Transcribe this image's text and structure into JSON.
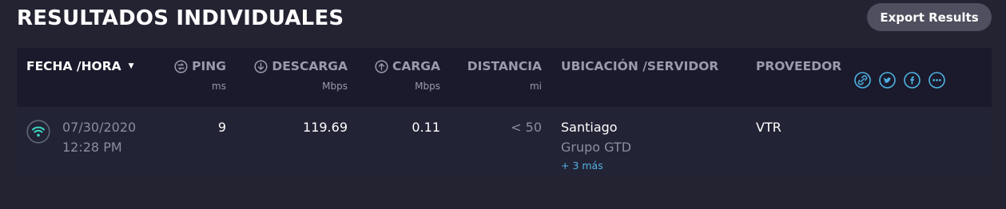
{
  "page": {
    "title": "RESULTADOS INDIVIDUALES",
    "export_label": "Export Results"
  },
  "table": {
    "headers": {
      "date": {
        "label": "FECHA /HORA"
      },
      "ping": {
        "label": "PING",
        "unit": "ms"
      },
      "download": {
        "label": "DESCARGA",
        "unit": "Mbps"
      },
      "upload": {
        "label": "CARGA",
        "unit": "Mbps"
      },
      "distance": {
        "label": "DISTANCIA",
        "unit": "mi"
      },
      "server": {
        "label": "UBICACIÓN /SERVIDOR"
      },
      "provider": {
        "label": "PROVEEDOR"
      }
    },
    "rows": [
      {
        "date": "07/30/2020",
        "time": "12:28 PM",
        "ping": "9",
        "download": "119.69",
        "upload": "0.11",
        "distance": "< 50",
        "location": "Santiago",
        "server": "Grupo GTD",
        "more": "+ 3 más",
        "provider": "VTR"
      }
    ]
  },
  "icons": {
    "connection": "wifi-icon",
    "sort": "sort-down-caret",
    "ping": "ping-icon",
    "download": "download-arrow-icon",
    "upload": "upload-arrow-icon",
    "share": [
      "link-icon",
      "twitter-icon",
      "facebook-icon",
      "more-icon"
    ]
  },
  "colors": {
    "background": "#232332",
    "header_bg": "#1a1a2c",
    "accent": "#4fb3e3",
    "wifi": "#3dd6c0",
    "muted": "#9a9aae"
  }
}
